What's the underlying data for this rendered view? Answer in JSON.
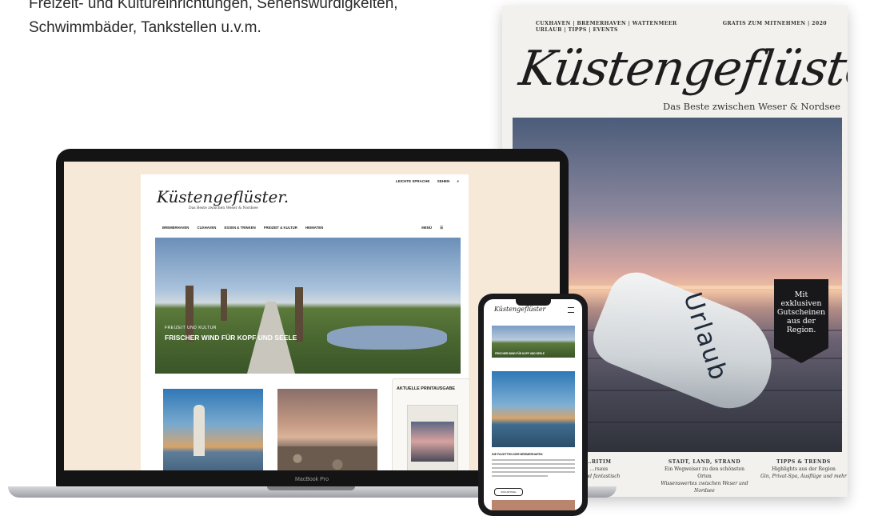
{
  "intro": {
    "line1": "Freizeit- und Kultureinrichtungen, Sehenswürdigkeiten,",
    "line2": "Schwimmbäder, Tankstellen u.v.m."
  },
  "magazine": {
    "top_left": "CUXHAVEN | BREMERHAVEN | WATTENMEER URLAUB | TIPPS | EVENTS",
    "top_right": "GRATIS ZUM MITNEHMEN | 2020",
    "logo": "Küstengeflüster.",
    "subtitle": "Das Beste zwischen Weser & Nordsee",
    "ribbon_text": "Mit exklusiven Gutscheinen aus der Region.",
    "buoy_text": "Urlaub",
    "bottom_columns": [
      {
        "title": "…RITIM",
        "line1": "…rsaus",
        "line2": "…und fantastisch"
      },
      {
        "title": "STADT, LAND, STRAND",
        "line1": "Ein Wegweiser zu den schönsten Orten",
        "line2": "Wissenswertes zwischen Weser und Nordsee"
      },
      {
        "title": "TIPPS & TRENDS",
        "line1": "Highlights aus der Region",
        "line2": "Gin, Privat-Spa, Ausflüge und mehr"
      }
    ]
  },
  "laptop": {
    "label": "MacBook Pro",
    "site": {
      "top_links": [
        "LEICHTE SPRACHE",
        "SEHEN"
      ],
      "logo": "Küstengeflüster.",
      "subtitle": "Das Beste zwischen Weser & Nordsee",
      "nav": [
        "BREMERHAVEN",
        "CUXHAVEN",
        "ESSEN & TRINKEN",
        "FREIZEIT & KULTUR",
        "HEIMATEN"
      ],
      "menu_label": "MENÜ",
      "hero_kicker": "FREIZEIT UND KULTUR",
      "hero_title": "FRISCHER WIND FÜR KOPF UND SEELE",
      "aside_title": "AKTUELLE PRINTAUSGABE"
    }
  },
  "phone": {
    "logo": "Küstengeflüster",
    "hero_title": "FRISCHER WIND FÜR KOPF UND SEELE",
    "heading": "DIE FACETTEN DER BREMERHAFEN",
    "button": "ZUM ARTIKEL"
  }
}
